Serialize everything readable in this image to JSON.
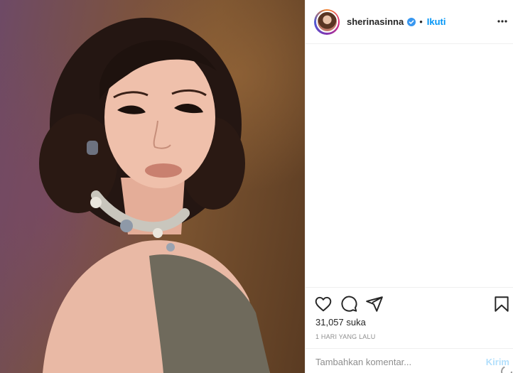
{
  "post": {
    "author": {
      "username": "sherinasinna",
      "verified": true,
      "follow_label": "Ikuti",
      "separator": "•"
    },
    "photo": {
      "description_icon": "portrait-photo"
    },
    "actions": {
      "like_icon": "heart-icon",
      "comment_icon": "comment-icon",
      "share_icon": "share-icon",
      "save_icon": "bookmark-icon"
    },
    "likes_text": "31,057 suka",
    "timestamp": "1 HARI YANG LALU",
    "comment": {
      "placeholder": "Tambahkan komentar...",
      "post_label": "Kirim"
    }
  },
  "colors": {
    "accent": "#0095f6",
    "post_disabled": "#b2dffc",
    "text": "#262626",
    "muted": "#8e8e8e",
    "border": "#efefef"
  }
}
